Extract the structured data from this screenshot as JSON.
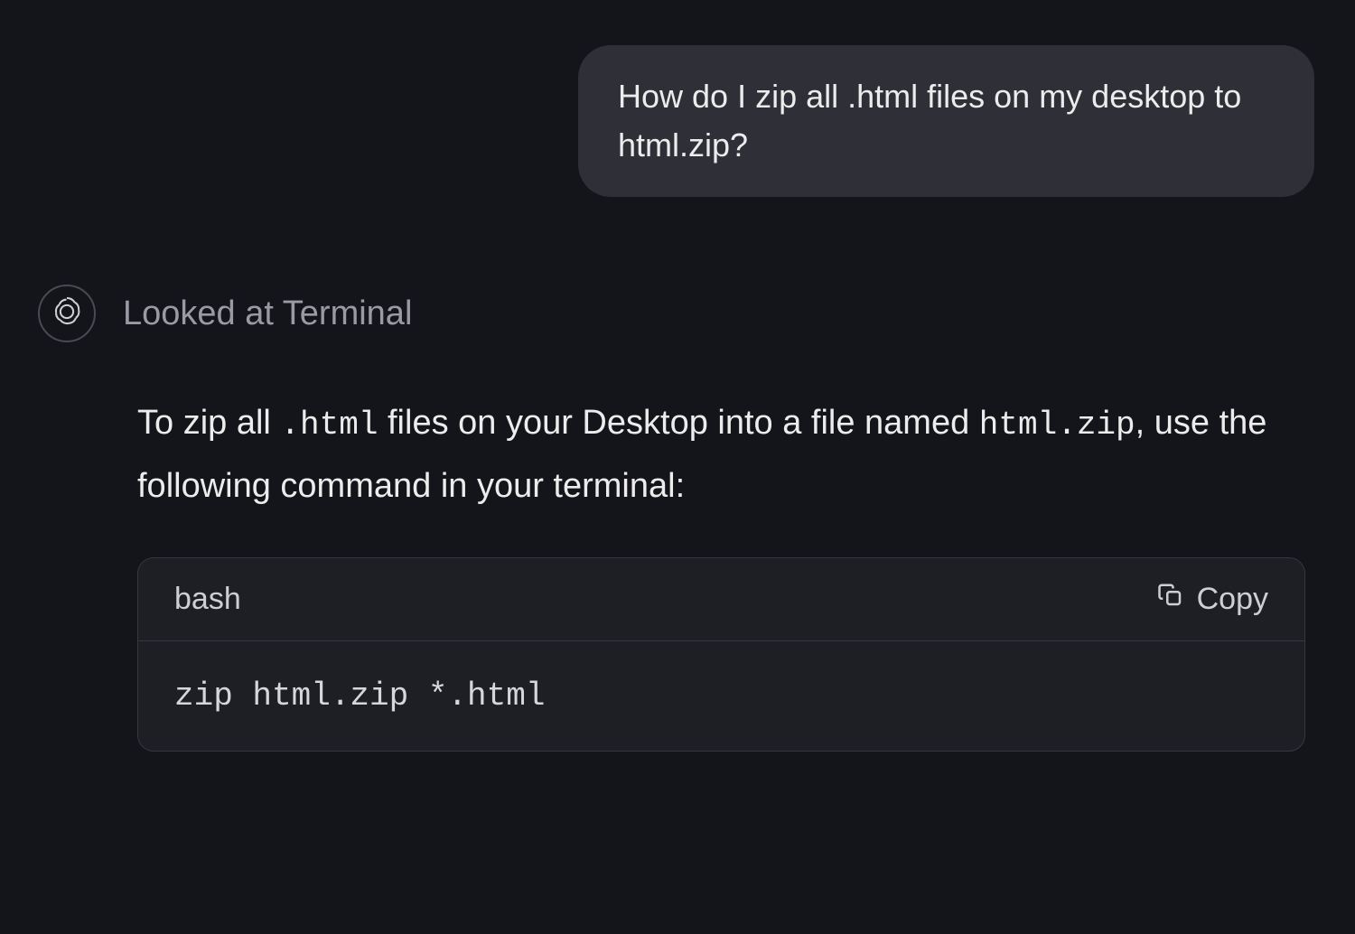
{
  "user_message": "How do I zip all .html files on my desktop to html.zip?",
  "assistant": {
    "status": "Looked at Terminal",
    "response_before_code1": "To zip all ",
    "response_code1": ".html",
    "response_mid": " files on your Desktop into a file named ",
    "response_code2": "html.zip",
    "response_after": ", use the following command in your terminal:"
  },
  "code_block": {
    "language": "bash",
    "copy_label": "Copy",
    "code": "zip html.zip *.html"
  }
}
